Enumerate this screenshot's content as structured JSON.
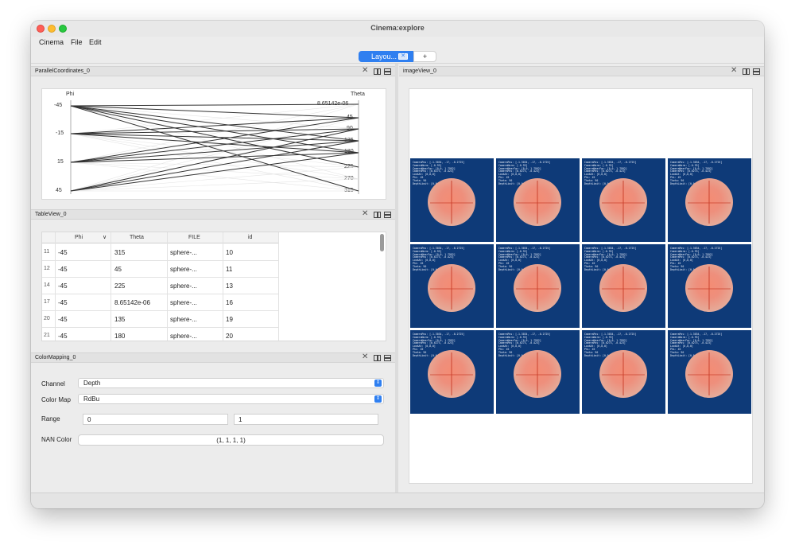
{
  "window": {
    "title": "Cinema:explore"
  },
  "menu": [
    "Cinema",
    "File",
    "Edit"
  ],
  "tabs": {
    "active_label": "Layou...",
    "add_label": "+"
  },
  "panels": {
    "parallel": {
      "title": "ParallelCoordinates_0"
    },
    "table": {
      "title": "TableView_0"
    },
    "colormap": {
      "title": "ColorMapping_0"
    },
    "image": {
      "title": "imageView_0"
    }
  },
  "parallel_coords": {
    "axes": [
      {
        "name": "Phi",
        "ticks": [
          "-45",
          "-15",
          "15",
          "45"
        ]
      },
      {
        "name": "Theta",
        "ticks": [
          "8.65142e-06",
          "45",
          "90",
          "135",
          "180",
          "225",
          "270",
          "315"
        ]
      }
    ],
    "lines": [
      [
        -45,
        315
      ],
      [
        -45,
        45
      ],
      [
        -45,
        225
      ],
      [
        -45,
        8.65142e-06
      ],
      [
        -45,
        135
      ],
      [
        -45,
        180
      ],
      [
        -15,
        90
      ],
      [
        -15,
        135
      ],
      [
        -15,
        180
      ],
      [
        -15,
        45
      ],
      [
        15,
        90
      ],
      [
        15,
        135
      ],
      [
        15,
        180
      ],
      [
        15,
        45
      ],
      [
        45,
        90
      ],
      [
        45,
        135
      ],
      [
        45,
        180
      ]
    ]
  },
  "table": {
    "columns": [
      "Phi",
      "Theta",
      "FILE",
      "id"
    ],
    "sort_indicator": "∨",
    "rows": [
      {
        "row": "11",
        "phi": "-45",
        "theta": "315",
        "file": "sphere-...",
        "id": "10"
      },
      {
        "row": "12",
        "phi": "-45",
        "theta": "45",
        "file": "sphere-...",
        "id": "11"
      },
      {
        "row": "14",
        "phi": "-45",
        "theta": "225",
        "file": "sphere-...",
        "id": "13"
      },
      {
        "row": "17",
        "phi": "-45",
        "theta": "8.65142e-06",
        "file": "sphere-...",
        "id": "16"
      },
      {
        "row": "20",
        "phi": "-45",
        "theta": "135",
        "file": "sphere-...",
        "id": "19"
      },
      {
        "row": "21",
        "phi": "-45",
        "theta": "180",
        "file": "sphere-...",
        "id": "20"
      }
    ]
  },
  "colormap": {
    "channel_label": "Channel",
    "channel_value": "Depth",
    "map_label": "Color Map",
    "map_value": "RdBu",
    "range_label": "Range",
    "range_min": "0",
    "range_max": "1",
    "nan_label": "NAN Color",
    "nan_value": "(1, 1, 1, 1)"
  },
  "colors": {
    "accent": "#2f7ff0",
    "tile_bg": "#0e3a78",
    "sphere": "#ee8f7c"
  }
}
